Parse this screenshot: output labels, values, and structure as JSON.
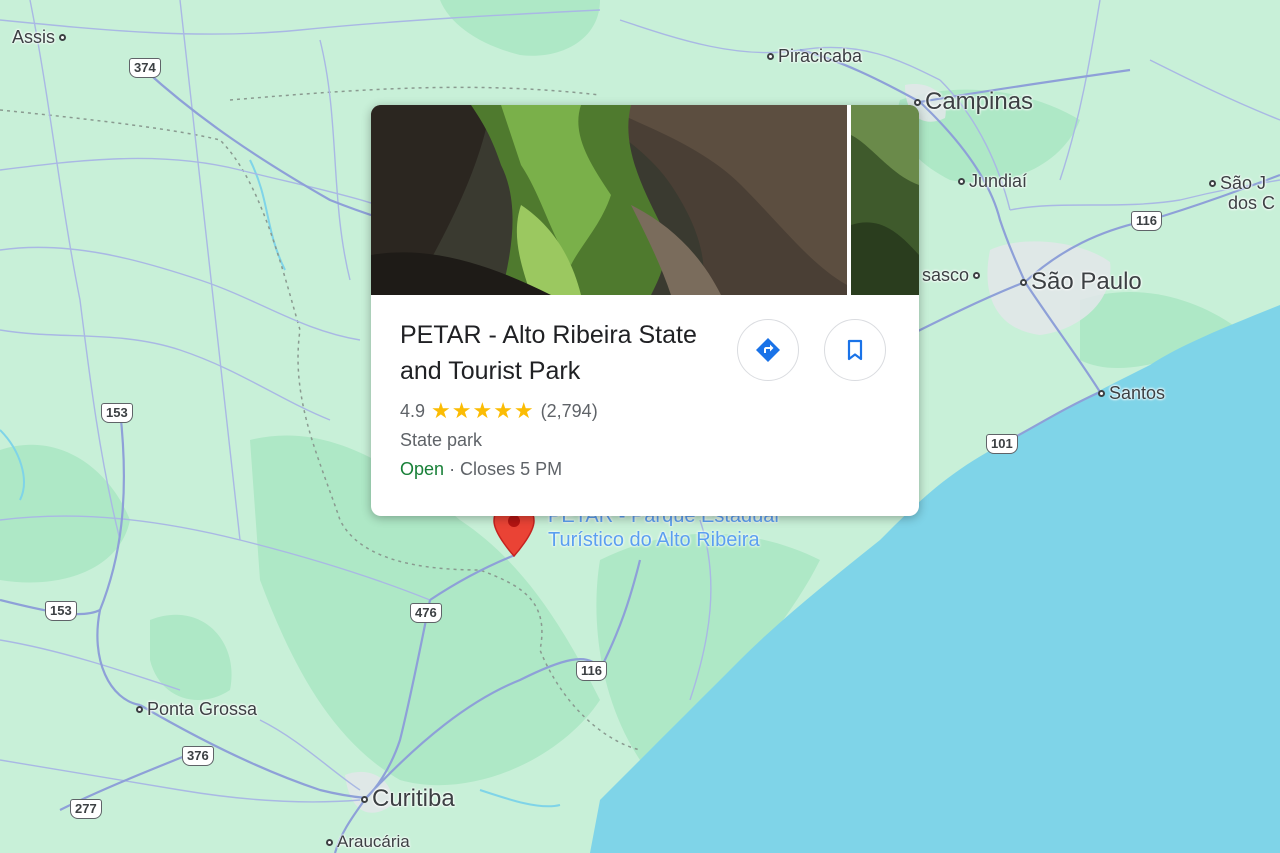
{
  "map": {
    "colors": {
      "land": "#c8f0d8",
      "land_dark": "#a8e6c0",
      "water": "#7fd4e8",
      "roads": "#8ea0d8",
      "urban": "#dfe3e8"
    },
    "cities": [
      {
        "name": "Assis",
        "size": "small"
      },
      {
        "name": "Piracicaba",
        "size": "small"
      },
      {
        "name": "Campinas",
        "size": "big"
      },
      {
        "name": "Jundiaí",
        "size": "small"
      },
      {
        "name": "São J",
        "size": "small"
      },
      {
        "name": "dos C",
        "size": "small"
      },
      {
        "name": "sasco",
        "size": "small"
      },
      {
        "name": "São Paulo",
        "size": "big"
      },
      {
        "name": "Santos",
        "size": "small"
      },
      {
        "name": "Ponta Grossa",
        "size": "small"
      },
      {
        "name": "Curitiba",
        "size": "big"
      },
      {
        "name": "Araucária",
        "size": "small"
      }
    ],
    "highway_shields": [
      "374",
      "116",
      "153",
      "101",
      "153",
      "476",
      "116",
      "376",
      "277"
    ],
    "poi_label_line1": "PETAR - Parque Estadual",
    "poi_label_line2": "Turístico do Alto Ribeira",
    "marker_icon": "map-pin-icon"
  },
  "place_card": {
    "title": "PETAR - Alto Ribeira State and Tourist Park",
    "rating": "4.9",
    "stars": "★★★★★",
    "review_count": "(2,794)",
    "category": "State park",
    "status": "Open",
    "hours": "· Closes 5 PM",
    "directions_icon": "directions-icon",
    "save_icon": "bookmark-icon"
  }
}
